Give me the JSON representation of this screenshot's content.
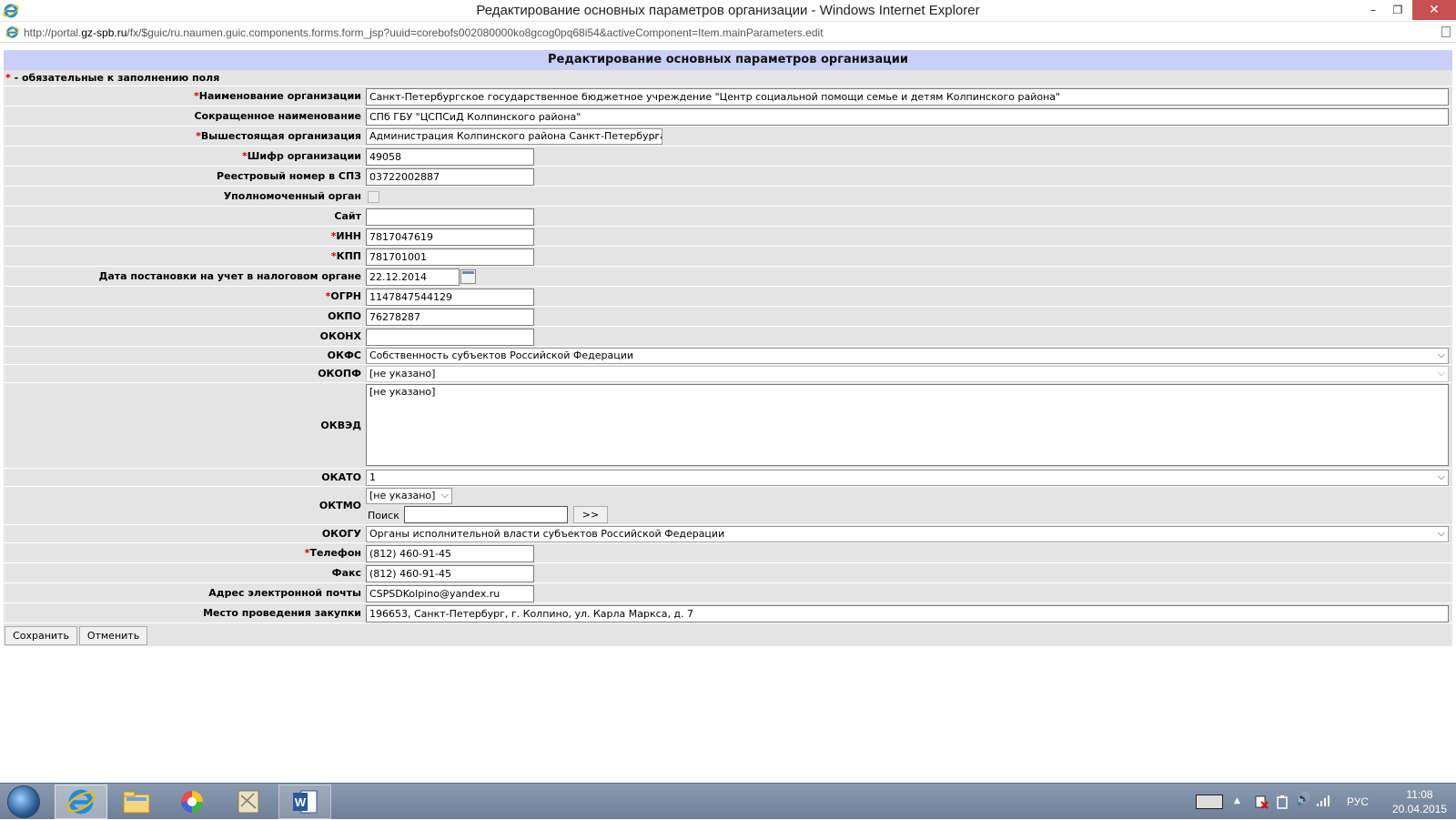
{
  "window": {
    "title": "Редактирование основных параметров организации - Windows Internet Explorer",
    "url_prefix": "http://portal.",
    "url_domain": "gz-spb.ru",
    "url_rest": "/fx/$guic/ru.naumen.guic.components.forms.form_jsp?uuid=corebofs002080000ko8gcog0pq68i54&activeComponent=Item.mainParameters.edit",
    "min_glyph": "–",
    "max_glyph": "❐",
    "close_glyph": "✕"
  },
  "form": {
    "header": "Редактирование основных параметров организации",
    "required_mark": "*",
    "legend": " - обязательные к заполнению поля",
    "fields": {
      "name": {
        "label": "Наименование организации",
        "value": "Санкт-Петербургское государственное бюджетное учреждение \"Центр социальной помощи семье и детям Колпинского района\""
      },
      "short_name": {
        "label": "Сокращенное наименование",
        "value": "СПб ГБУ \"ЦСПСиД Колпинского района\""
      },
      "parent_org": {
        "label": "Вышестоящая организация",
        "value": "Администрация Колпинского района Санкт-Петербурга"
      },
      "cipher": {
        "label": "Шифр организации",
        "value": "49058"
      },
      "registry": {
        "label": "Реестровый номер в СПЗ",
        "value": "03722002887"
      },
      "authorized": {
        "label": "Уполномоченный орган",
        "checked": false
      },
      "site": {
        "label": "Сайт",
        "value": ""
      },
      "inn": {
        "label": "ИНН",
        "value": "7817047619"
      },
      "kpp": {
        "label": "КПП",
        "value": "781701001"
      },
      "tax_date": {
        "label": "Дата постановки на учет в налоговом органе",
        "value": "22.12.2014"
      },
      "ogrn": {
        "label": "ОГРН",
        "value": "1147847544129"
      },
      "okpo": {
        "label": "ОКПО",
        "value": "76278287"
      },
      "okonh": {
        "label": "ОКОНХ",
        "value": ""
      },
      "okfs": {
        "label": "ОКФС",
        "value": "Собственность субъектов Российской Федерации"
      },
      "okopf": {
        "label": "ОКОПФ",
        "value": "[не указано]"
      },
      "okved": {
        "label": "ОКВЭД",
        "value": "[не указано]"
      },
      "okato": {
        "label": "ОКАТО",
        "value": "1"
      },
      "oktmo": {
        "label": "ОКТМО",
        "value": "[не указано]",
        "search_label": "Поиск",
        "search_value": "",
        "search_button": ">>"
      },
      "okogu": {
        "label": "ОКОГУ",
        "value": "Органы исполнительной власти субъектов Российской Федерации"
      },
      "phone": {
        "label": "Телефон",
        "value": "(812) 460-91-45"
      },
      "fax": {
        "label": "Факс",
        "value": "(812) 460-91-45"
      },
      "email": {
        "label": "Адрес электронной почты",
        "value": "CSPSDKolpino@yandex.ru"
      },
      "place": {
        "label": "Место проведения закупки",
        "value": "196653, Санкт-Петербург, г. Колпино, ул. Карла Маркса, д. 7"
      }
    },
    "buttons": {
      "save": "Сохранить",
      "cancel": "Отменить"
    }
  },
  "taskbar": {
    "language": "РУС",
    "time": "11:08",
    "date": "20.04.2015",
    "word_icon_letter": "W",
    "tray_up_glyph": "▲",
    "volume_glyph": "🔊"
  }
}
